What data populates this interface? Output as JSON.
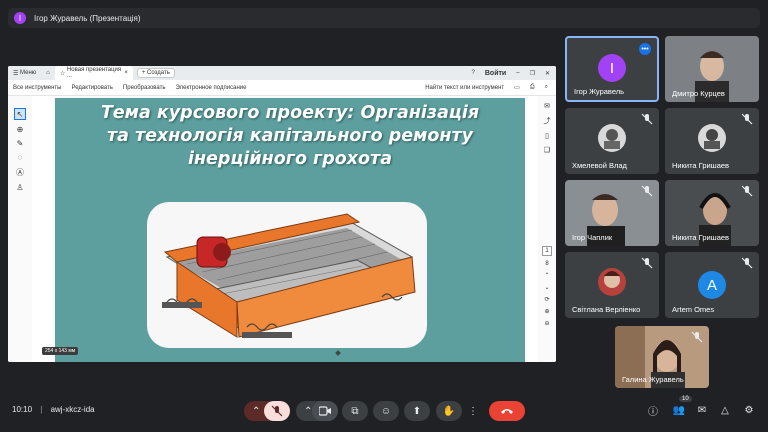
{
  "topbar": {
    "initial": "І",
    "title": "Ігор Журавель (Презентація)"
  },
  "browser": {
    "menu_label": "Меню",
    "tab_label": "Новая презентация ...",
    "new_tab_label": "+ Создать",
    "signin_label": "Войти",
    "menu_items": [
      "Все инструменты",
      "Редактировать",
      "Преобразовать",
      "Электронное подписание"
    ],
    "search_label": "Найти текст или инструмент",
    "page_number": "1",
    "page_total": "8",
    "dim_label": "254 x 143 мм"
  },
  "slide": {
    "title_lines": [
      "Тема курсового проекту: Організація",
      "та технологія капітального ремонту",
      "інерційного грохота"
    ]
  },
  "participants": [
    {
      "name": "Ігор Журавель",
      "initial": "І",
      "color": "#a142f4",
      "kind": "avatar"
    },
    {
      "name": "Дмитро Курцев",
      "kind": "video"
    },
    {
      "name": "Хмелевой Влад",
      "kind": "photo"
    },
    {
      "name": "Никита Гришаев",
      "kind": "photo"
    },
    {
      "name": "Ігор Чаплик",
      "kind": "video"
    },
    {
      "name": "Никита Гришаев",
      "kind": "video"
    },
    {
      "name": "Світлана Верліенко",
      "kind": "photo"
    },
    {
      "name": "Artem Omes",
      "initial": "A",
      "color": "#1e88e5",
      "kind": "avatar"
    },
    {
      "name": "Галина Журавель",
      "kind": "video"
    }
  ],
  "bottombar": {
    "time": "10:10",
    "separator": "|",
    "meeting_code": "awj-xkcz-ida",
    "participants_count": "10"
  }
}
